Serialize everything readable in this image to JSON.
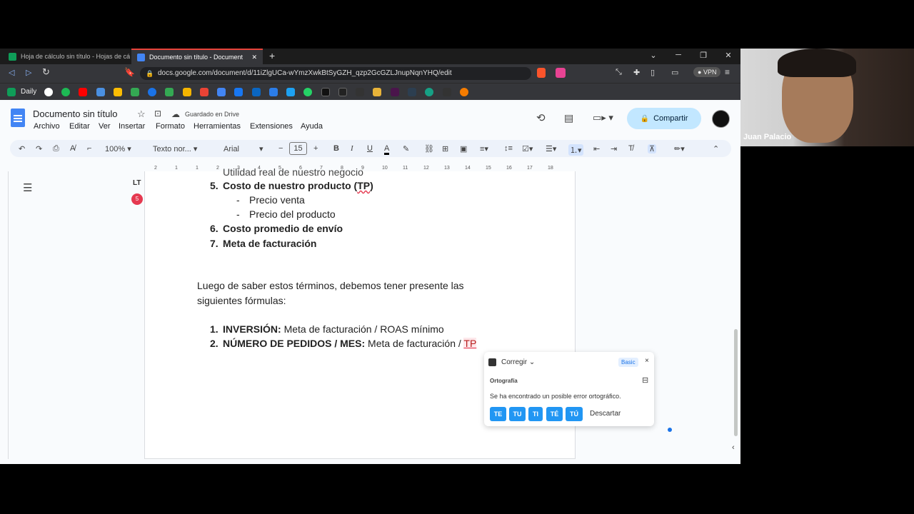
{
  "browser": {
    "tabs": [
      {
        "label": "Hoja de cálculo sin título - Hojas de cá",
        "active": false
      },
      {
        "label": "Documento sin título - Document",
        "active": true
      }
    ],
    "url": "docs.google.com/document/d/11iZlgUCa-wYmzXwkBtSyGZH_qzp2GcGZLJnupNqnYHQ/edit",
    "vpn_label": "VPN",
    "bookmark_daily": "Daily"
  },
  "doc": {
    "title": "Documento sin título",
    "saved_status": "Guardado en Drive",
    "share_label": "Compartir",
    "menus": [
      "Archivo",
      "Editar",
      "Ver",
      "Insertar",
      "Formato",
      "Herramientas",
      "Extensiones",
      "Ayuda"
    ]
  },
  "toolbar": {
    "zoom": "100%",
    "style": "Texto nor...",
    "font": "Arial",
    "font_size": "15"
  },
  "ruler": {
    "ticks": [
      "2",
      "1",
      "1",
      "2",
      "3",
      "4",
      "5",
      "6",
      "7",
      "8",
      "9",
      "10",
      "11",
      "12",
      "13",
      "14",
      "15",
      "16",
      "17",
      "18"
    ]
  },
  "content": {
    "cut_line": "Utilidad real de nuestro negocio",
    "item5_num": "5.",
    "item5": "Costo de nuestro producto (",
    "item5_tp": "TP",
    "item5_end": ")",
    "sub1": "Precio venta",
    "sub2": "Precio del producto",
    "item6_num": "6.",
    "item6": "Costo promedio de envío",
    "item7_num": "7.",
    "item7": "Meta de facturación",
    "para1": "Luego de saber estos términos, debemos tener presente las",
    "para2": "siguientes fórmulas:",
    "f1_num": "1.",
    "f1_bold": "INVERSIÓN:",
    "f1_text": " Meta de facturación / ROAS mínimo",
    "f2_num": "2.",
    "f2_bold": "NÚMERO DE PEDIDOS / MES:",
    "f2_text": " Meta de facturación / ",
    "f2_tp": "TP"
  },
  "lt_popup": {
    "title": "Corregir",
    "badge": "Basic",
    "category": "Ortografía",
    "message": "Se ha encontrado un posible error ortográfico.",
    "suggestions": [
      "TE",
      "TU",
      "TI",
      "TÉ",
      "TÚ"
    ],
    "dismiss": "Descartar",
    "lt_count": "5"
  },
  "webcam": {
    "name": "Juan Palacio"
  }
}
